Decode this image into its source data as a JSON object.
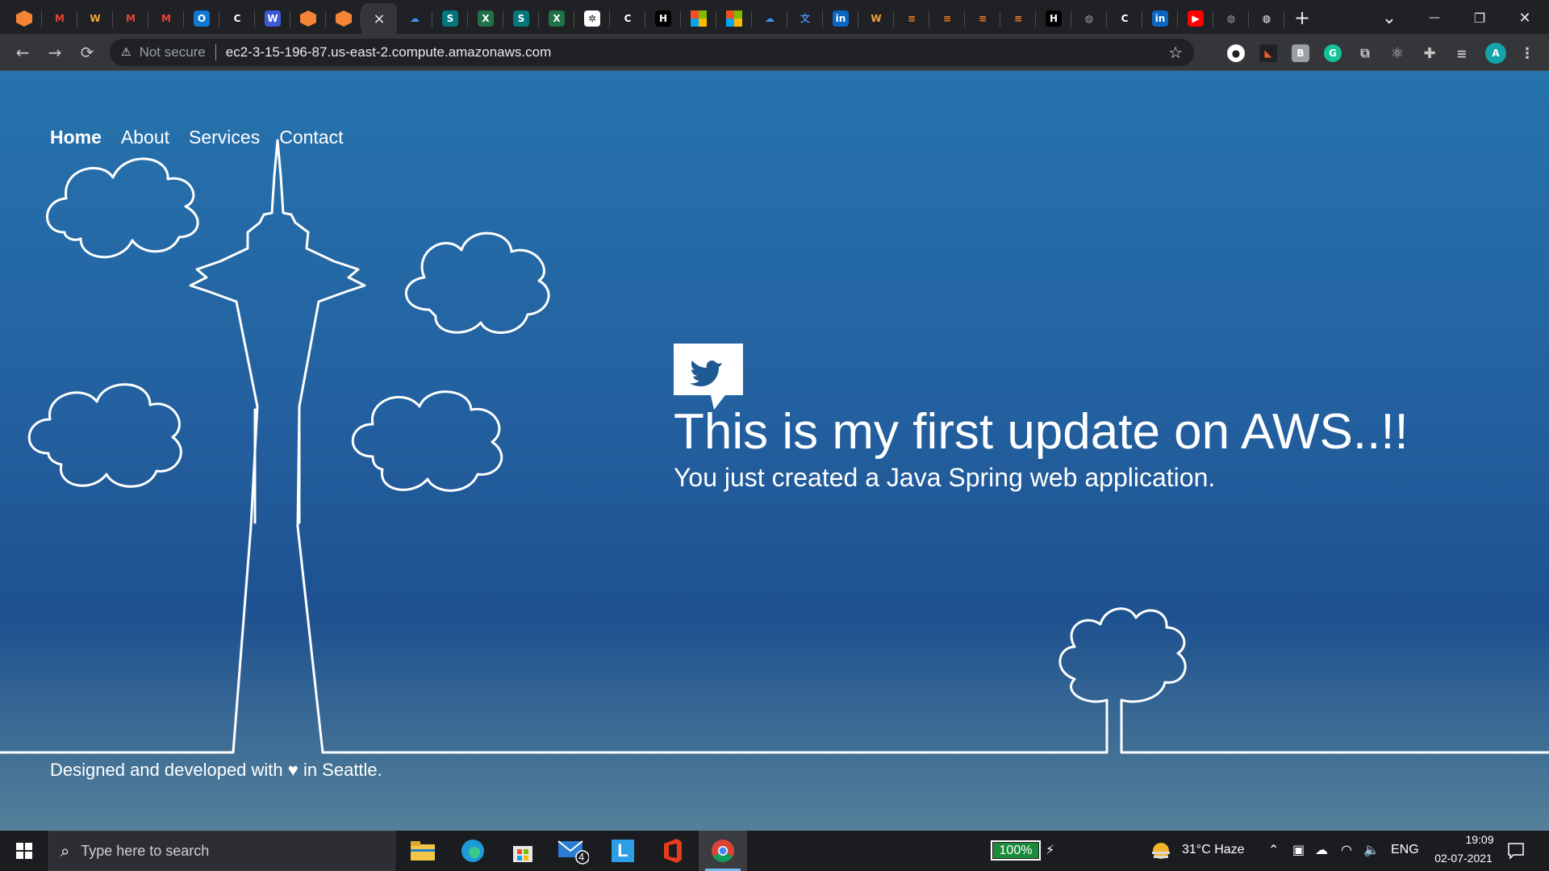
{
  "browser": {
    "tabs": [
      {
        "icon": "aws-icon",
        "glyph": "",
        "color": "#f58536"
      },
      {
        "icon": "gmail-icon",
        "glyph": "M",
        "color": "#202124",
        "fg": "#ea4335"
      },
      {
        "icon": "webex-icon",
        "glyph": "W",
        "color": "#202124",
        "fg": "#f3a536"
      },
      {
        "icon": "gmail-icon",
        "glyph": "M",
        "color": "#202124",
        "fg": "#ea4335"
      },
      {
        "icon": "gmail-icon",
        "glyph": "M",
        "color": "#202124",
        "fg": "#ea4335"
      },
      {
        "icon": "outlook-icon",
        "glyph": "O",
        "color": "#0f78d4"
      },
      {
        "icon": "c-icon",
        "glyph": "C",
        "color": "#202124",
        "fg": "#ffffff"
      },
      {
        "icon": "w-icon",
        "glyph": "W",
        "color": "#3d5bd8"
      },
      {
        "icon": "aws-icon",
        "glyph": "",
        "color": "#f58536"
      },
      {
        "icon": "aws-icon",
        "glyph": "",
        "color": "#f58536"
      },
      {
        "icon": "close-icon",
        "glyph": "×",
        "active": true
      },
      {
        "icon": "onedrive-icon",
        "glyph": "☁",
        "color": "#202124",
        "fg": "#3a8ff0"
      },
      {
        "icon": "sharepoint-icon",
        "glyph": "S",
        "color": "#03787c"
      },
      {
        "icon": "excel-icon",
        "glyph": "X",
        "color": "#1f7246"
      },
      {
        "icon": "sharepoint-icon",
        "glyph": "S",
        "color": "#03787c"
      },
      {
        "icon": "excel-icon",
        "glyph": "X",
        "color": "#1f7246"
      },
      {
        "icon": "openai-icon",
        "glyph": "✲",
        "color": "#ffffff",
        "fg": "#202124"
      },
      {
        "icon": "c-icon",
        "glyph": "C",
        "color": "#202124",
        "fg": "#ffffff"
      },
      {
        "icon": "hackerrank-icon",
        "glyph": "H",
        "color": "#000000"
      },
      {
        "icon": "microsoft-icon",
        "glyph": "",
        "color": "ms"
      },
      {
        "icon": "microsoft-icon",
        "glyph": "",
        "color": "ms"
      },
      {
        "icon": "onedrive-icon",
        "glyph": "☁",
        "color": "#202124",
        "fg": "#3a8ff0"
      },
      {
        "icon": "translate-icon",
        "glyph": "文",
        "color": "#202124",
        "fg": "#4b8df8"
      },
      {
        "icon": "linkedin-icon",
        "glyph": "in",
        "color": "#0a66c2"
      },
      {
        "icon": "webex-icon",
        "glyph": "W",
        "color": "#202124",
        "fg": "#f3a536"
      },
      {
        "icon": "stackoverflow-icon",
        "glyph": "≡",
        "color": "#202124",
        "fg": "#f48024"
      },
      {
        "icon": "stackoverflow-icon",
        "glyph": "≡",
        "color": "#202124",
        "fg": "#f48024"
      },
      {
        "icon": "stackoverflow-icon",
        "glyph": "≡",
        "color": "#202124",
        "fg": "#f48024"
      },
      {
        "icon": "stackoverflow-icon",
        "glyph": "≡",
        "color": "#202124",
        "fg": "#f48024"
      },
      {
        "icon": "hackerrank-icon",
        "glyph": "H",
        "color": "#000000"
      },
      {
        "icon": "globe-icon",
        "glyph": "◍",
        "color": "#202124",
        "fg": "#9aa0a6"
      },
      {
        "icon": "c-icon",
        "glyph": "C",
        "color": "#202124",
        "fg": "#ffffff"
      },
      {
        "icon": "linkedin-icon",
        "glyph": "in",
        "color": "#0a66c2"
      },
      {
        "icon": "youtube-icon",
        "glyph": "▶",
        "color": "#ff0000"
      },
      {
        "icon": "globe-icon",
        "glyph": "◍",
        "color": "#202124",
        "fg": "#9aa0a6"
      },
      {
        "icon": "globe-icon",
        "glyph": "◍",
        "color": "#202124",
        "fg": "#ffffff"
      }
    ],
    "new_tab": "+",
    "window_controls": {
      "minimize": "—",
      "restore": "❐",
      "close": "✕"
    },
    "security_label": "Not secure",
    "url": "ec2-3-15-196-87.us-east-2.compute.amazonaws.com",
    "profile_initial": "A"
  },
  "page": {
    "nav": [
      "Home",
      "About",
      "Services",
      "Contact"
    ],
    "active_nav": "Home",
    "headline": "This is my first update on AWS..!!",
    "subheadline": "You just created a Java Spring web application.",
    "footer": "Designed and developed with ♥ in Seattle."
  },
  "taskbar": {
    "search_placeholder": "Type here to search",
    "mail_badge": "4",
    "battery": "100%",
    "battery_level": 1.0,
    "weather": "31°C  Haze",
    "language": "ENG",
    "time": "19:09",
    "date": "02-07-2021"
  }
}
